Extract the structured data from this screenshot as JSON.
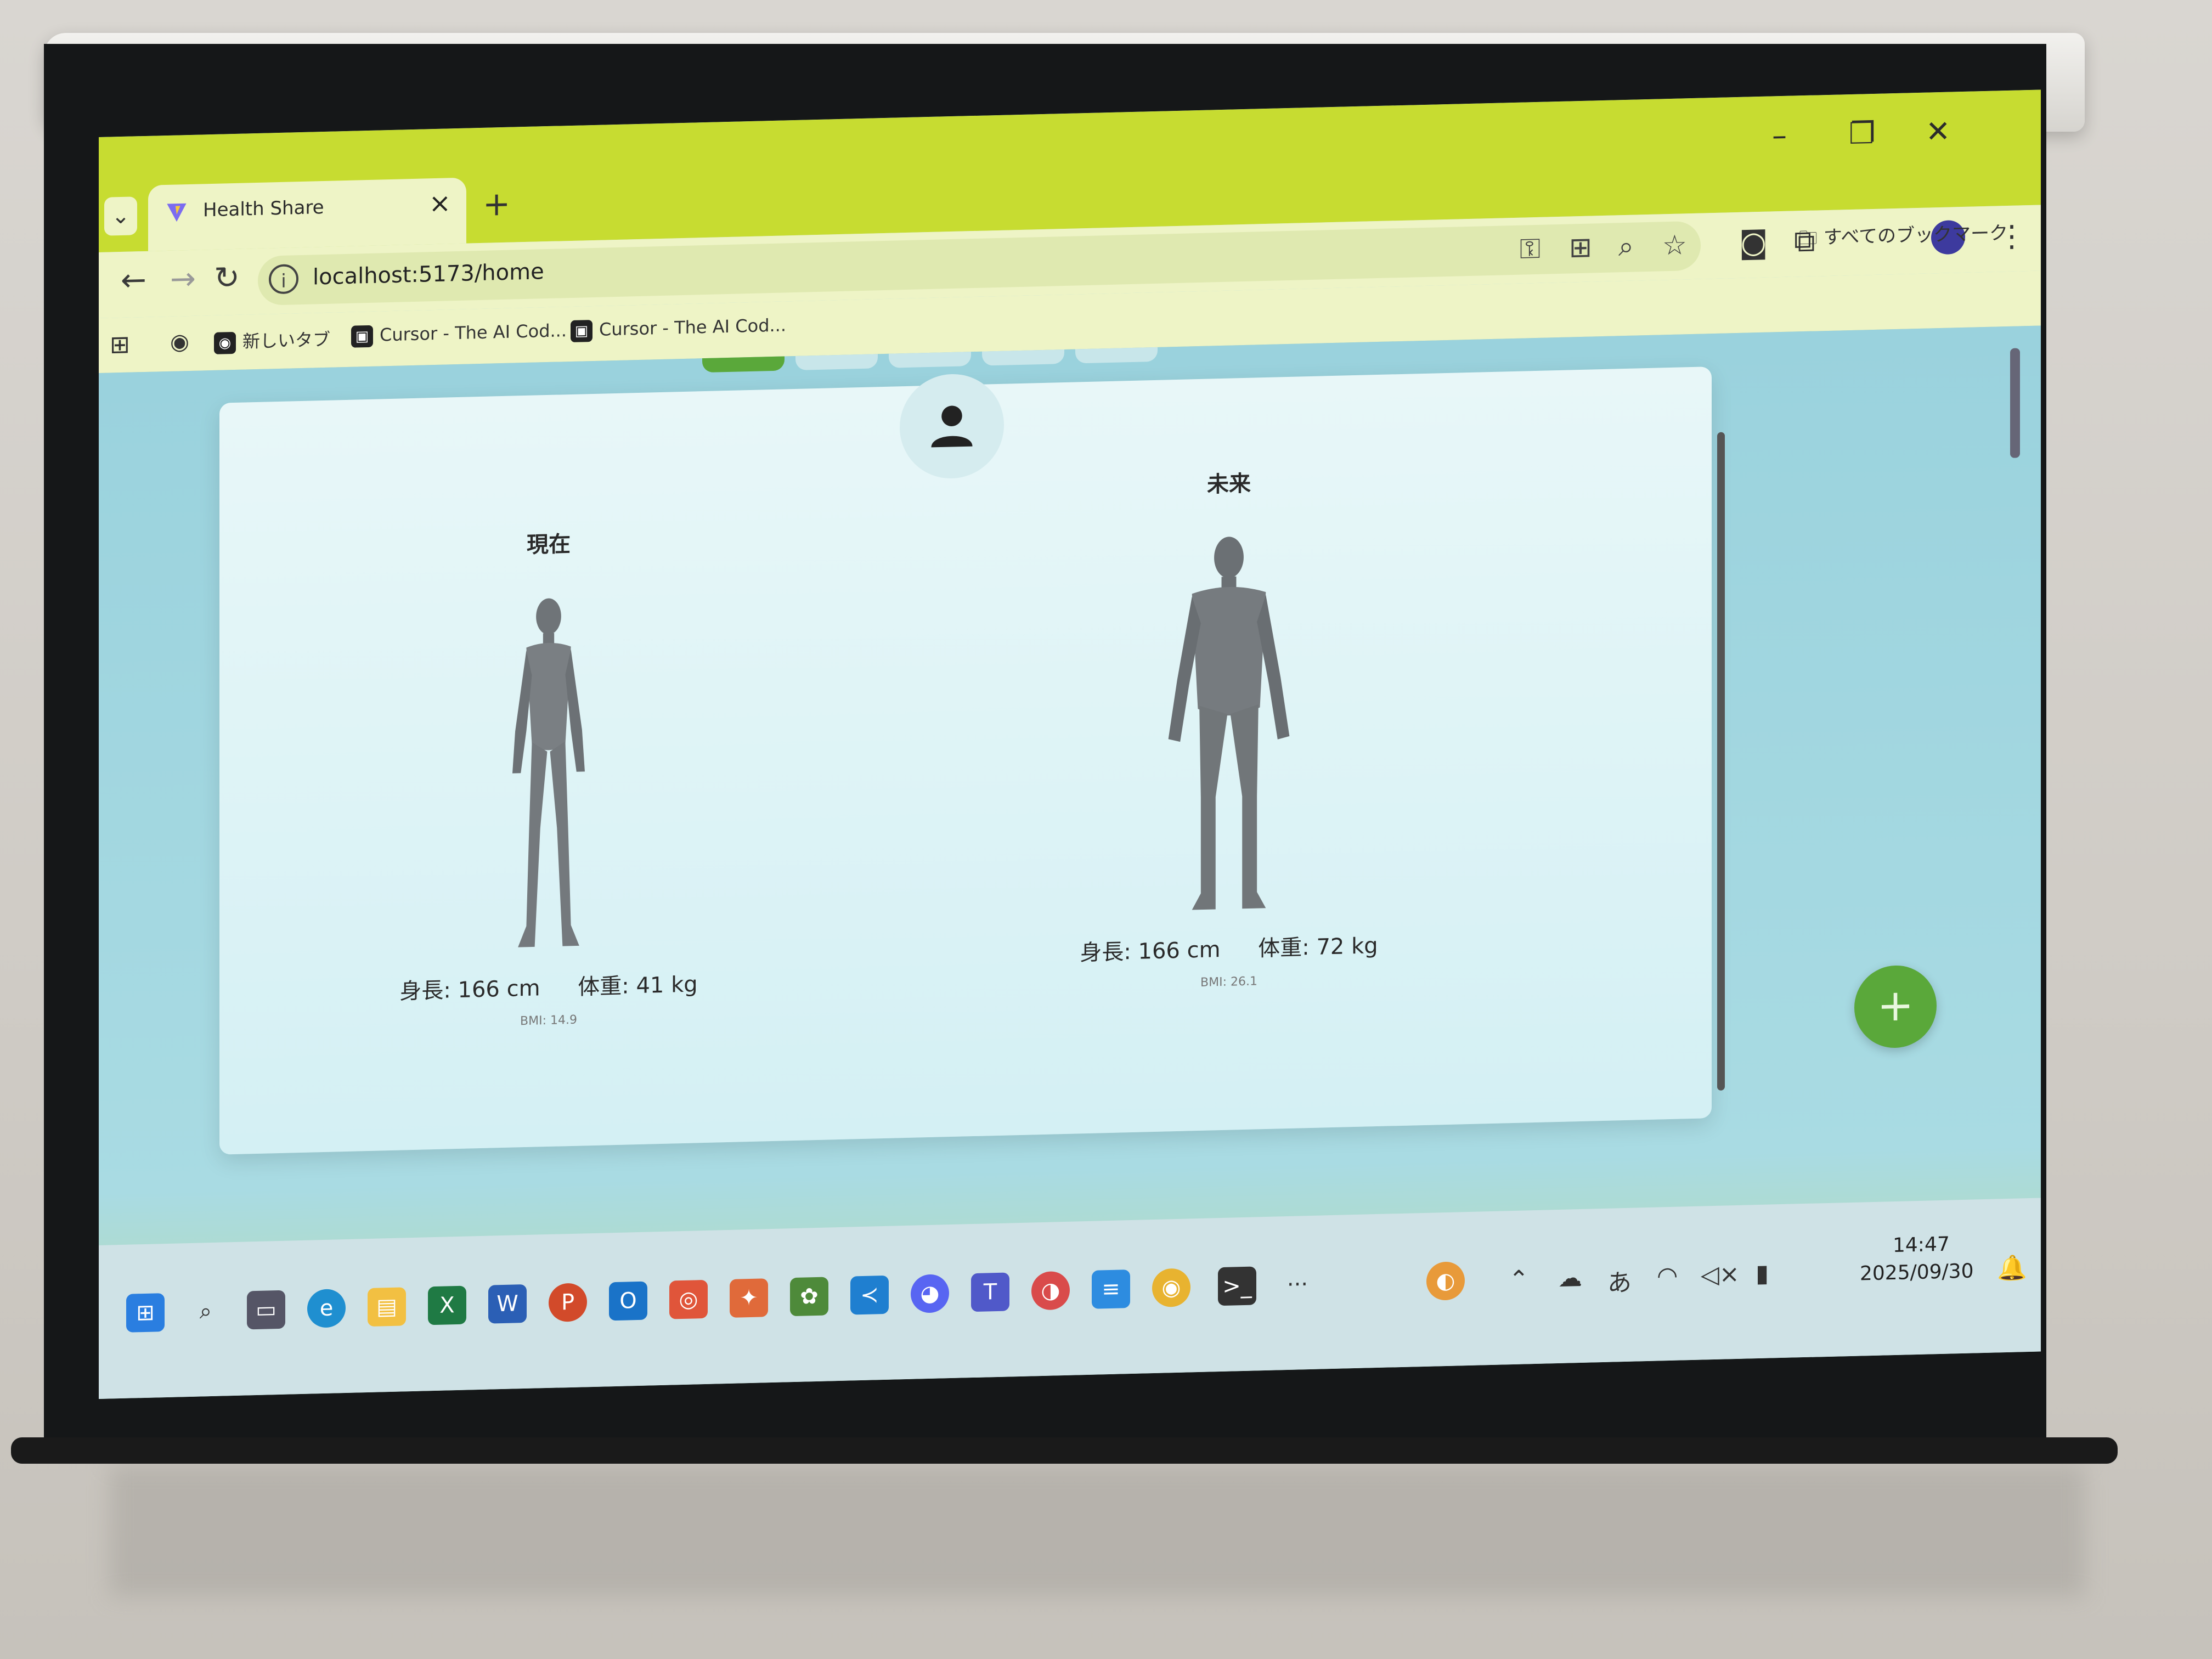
{
  "browser": {
    "tab_title": "Health Share",
    "tab_close": "×",
    "new_tab": "+",
    "tab_list": "⌄",
    "url": "localhost:5173/home",
    "window_controls": {
      "minimize": "–",
      "maximize": "❐",
      "close": "✕"
    },
    "all_bookmarks": "すべてのブックマーク",
    "bookmarks": [
      {
        "label": "新しいタブ"
      },
      {
        "label": "Cursor - The AI Cod..."
      },
      {
        "label": "Cursor - The AI Cod..."
      }
    ]
  },
  "profile": {
    "current": {
      "title": "現在",
      "height": "身長: 166 cm",
      "weight": "体重: 41 kg",
      "bmi": "BMI: 14.9"
    },
    "future": {
      "title": "未来",
      "height": "身長: 166 cm",
      "weight": "体重: 72 kg",
      "bmi": "BMI: 26.1"
    },
    "fab_label": "+"
  },
  "taskbar": {
    "time": "14:47",
    "date": "2025/09/30",
    "ime": "あ",
    "more": "···"
  },
  "colors": {
    "titlebar": "#c7dc31",
    "toolbar": "#eef4c6",
    "page_bg": "#a3d7e0",
    "fab": "#5aa83a"
  },
  "icons": [
    "windows-start-icon",
    "search-icon",
    "edge-icon",
    "file-explorer-icon",
    "excel-icon",
    "word-icon",
    "powerpoint-icon",
    "outlook-icon",
    "vscode-icon",
    "discord-icon",
    "teams-icon",
    "chrome-icon",
    "terminal-icon"
  ]
}
